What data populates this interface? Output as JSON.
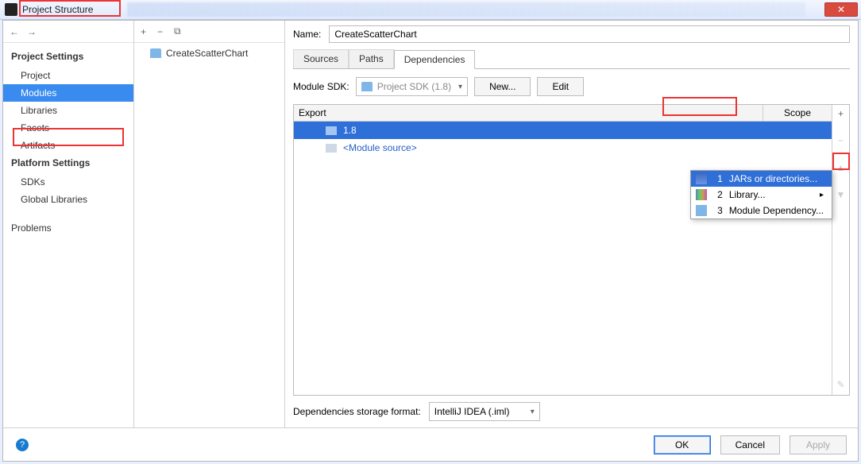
{
  "window": {
    "title": "Project Structure"
  },
  "sidebar": {
    "heading1": "Project Settings",
    "items1": [
      "Project",
      "Modules",
      "Libraries",
      "Facets",
      "Artifacts"
    ],
    "selected1": "Modules",
    "heading2": "Platform Settings",
    "items2": [
      "SDKs",
      "Global Libraries"
    ],
    "extra": "Problems"
  },
  "tree": {
    "module": "CreateScatterChart"
  },
  "detail": {
    "name_label": "Name:",
    "name_value": "CreateScatterChart",
    "tabs": [
      "Sources",
      "Paths",
      "Dependencies"
    ],
    "active_tab": "Dependencies",
    "sdk_label": "Module SDK:",
    "sdk_value": "Project SDK (1.8)",
    "new_btn": "New...",
    "edit_btn": "Edit",
    "col_export": "Export",
    "col_scope": "Scope",
    "rows": [
      "1.8",
      "<Module source>"
    ],
    "storage_label": "Dependencies storage format:",
    "storage_value": "IntelliJ IDEA (.iml)"
  },
  "popup": {
    "items": [
      {
        "n": "1",
        "label": "JARs or directories..."
      },
      {
        "n": "2",
        "label": "Library..."
      },
      {
        "n": "3",
        "label": "Module Dependency..."
      }
    ]
  },
  "buttons": {
    "ok": "OK",
    "cancel": "Cancel",
    "apply": "Apply"
  }
}
